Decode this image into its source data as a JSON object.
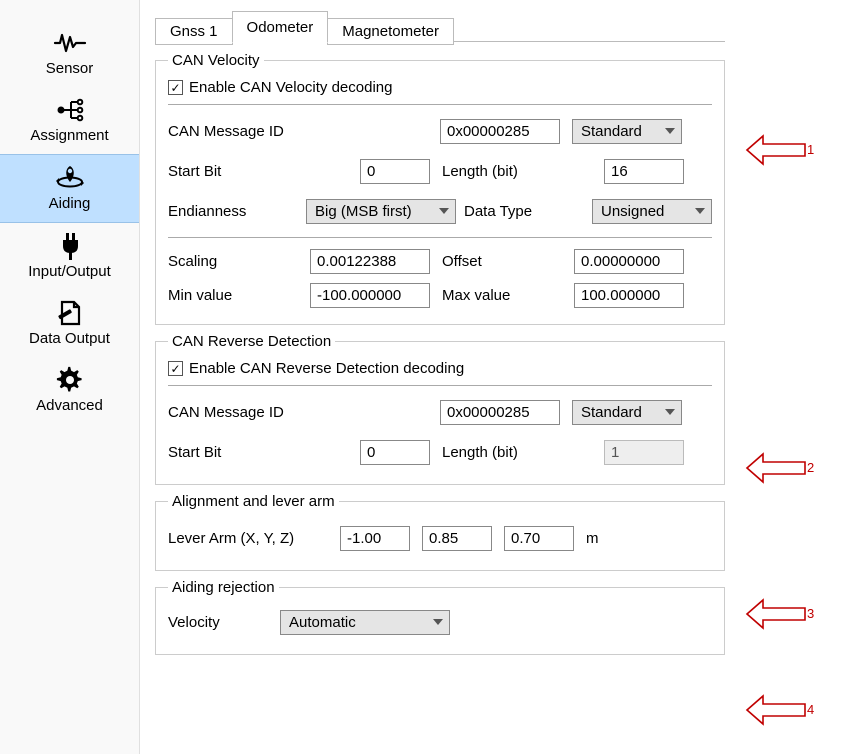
{
  "sidebar": {
    "items": [
      {
        "label": "Sensor",
        "icon": "waveform-icon"
      },
      {
        "label": "Assignment",
        "icon": "branch-icon"
      },
      {
        "label": "Aiding",
        "icon": "pin-orbit-icon"
      },
      {
        "label": "Input/Output",
        "icon": "plug-icon"
      },
      {
        "label": "Data Output",
        "icon": "document-pencil-icon"
      },
      {
        "label": "Advanced",
        "icon": "gear-icon"
      }
    ],
    "active_index": 2
  },
  "tabs": {
    "items": [
      "Gnss 1",
      "Odometer",
      "Magnetometer"
    ],
    "active_index": 1
  },
  "can_velocity": {
    "legend": "CAN Velocity",
    "enable_label": "Enable CAN Velocity decoding",
    "enable_checked": true,
    "msg_id_label": "CAN Message ID",
    "msg_id_value": "0x00000285",
    "id_type_value": "Standard",
    "start_bit_label": "Start Bit",
    "start_bit_value": "0",
    "length_label": "Length (bit)",
    "length_value": "16",
    "endian_label": "Endianness",
    "endian_value": "Big (MSB first)",
    "datatype_label": "Data Type",
    "datatype_value": "Unsigned",
    "scaling_label": "Scaling",
    "scaling_value": "0.00122388",
    "offset_label": "Offset",
    "offset_value": "0.00000000",
    "min_label": "Min value",
    "min_value": "-100.000000",
    "max_label": "Max value",
    "max_value": "100.000000"
  },
  "can_reverse": {
    "legend": "CAN Reverse Detection",
    "enable_label": "Enable CAN Reverse Detection decoding",
    "enable_checked": true,
    "msg_id_label": "CAN Message ID",
    "msg_id_value": "0x00000285",
    "id_type_value": "Standard",
    "start_bit_label": "Start Bit",
    "start_bit_value": "0",
    "length_label": "Length (bit)",
    "length_value": "1",
    "length_disabled": true
  },
  "alignment": {
    "legend": "Alignment and lever arm",
    "lever_label": "Lever Arm (X, Y, Z)",
    "x": "-1.00",
    "y": "0.85",
    "z": "0.70",
    "unit": "m"
  },
  "rejection": {
    "legend": "Aiding rejection",
    "velocity_label": "Velocity",
    "velocity_value": "Automatic"
  },
  "annotations": {
    "1": "1",
    "2": "2",
    "3": "3",
    "4": "4"
  }
}
